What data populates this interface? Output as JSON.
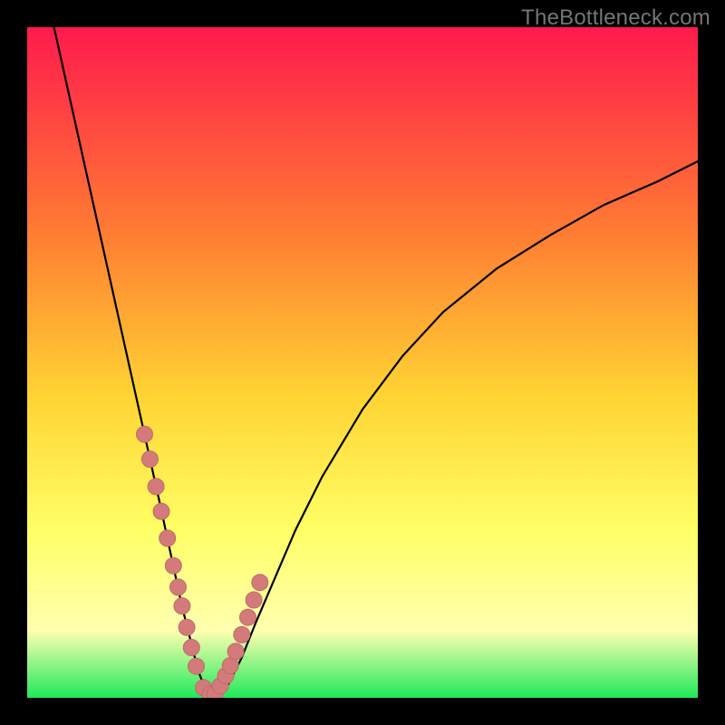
{
  "watermark": "TheBottleneck.com",
  "colors": {
    "gradient_top": "#ff1a4d",
    "gradient_mid1": "#ff7a33",
    "gradient_mid2": "#ffd433",
    "gradient_mid3": "#ffff66",
    "gradient_mid4": "#ffffb0",
    "gradient_bottom": "#1fe95a",
    "curve": "#000000",
    "marker_fill": "#d27b7a",
    "marker_stroke": "#c26a69",
    "frame": "#000000"
  },
  "chart_data": {
    "type": "line",
    "title": "",
    "xlabel": "",
    "ylabel": "",
    "xlim": [
      0,
      100
    ],
    "ylim": [
      0,
      100
    ],
    "series": [
      {
        "name": "bottleneck-curve",
        "x": [
          4,
          6,
          8,
          10,
          12,
          14,
          16,
          18,
          20,
          21.5,
          23,
          24.5,
          25.5,
          26.5,
          27.5,
          28,
          30,
          32,
          34,
          37,
          40,
          44,
          50,
          56,
          62,
          70,
          78,
          86,
          94,
          100
        ],
        "values": [
          100,
          91,
          82,
          73,
          64,
          55,
          46,
          37,
          28,
          21,
          14,
          8,
          4,
          1.5,
          0.5,
          0.5,
          2,
          6,
          11,
          18,
          25,
          33,
          43,
          51,
          57.5,
          64,
          69,
          73.5,
          77,
          80
        ]
      }
    ],
    "markers": {
      "name": "highlighted-points",
      "x": [
        17.5,
        18.3,
        19.2,
        20.0,
        20.9,
        21.8,
        22.5,
        23.1,
        23.8,
        24.5,
        25.2,
        26.3,
        27.3,
        28.0,
        28.8,
        29.6,
        30.3,
        31.1,
        32.0,
        32.9,
        33.8,
        34.7
      ],
      "values": [
        39.3,
        35.6,
        31.5,
        27.8,
        23.8,
        19.7,
        16.5,
        13.7,
        10.5,
        7.5,
        4.7,
        1.5,
        0.6,
        0.6,
        1.8,
        3.3,
        4.8,
        6.9,
        9.4,
        12.0,
        14.6,
        17.2
      ]
    }
  }
}
